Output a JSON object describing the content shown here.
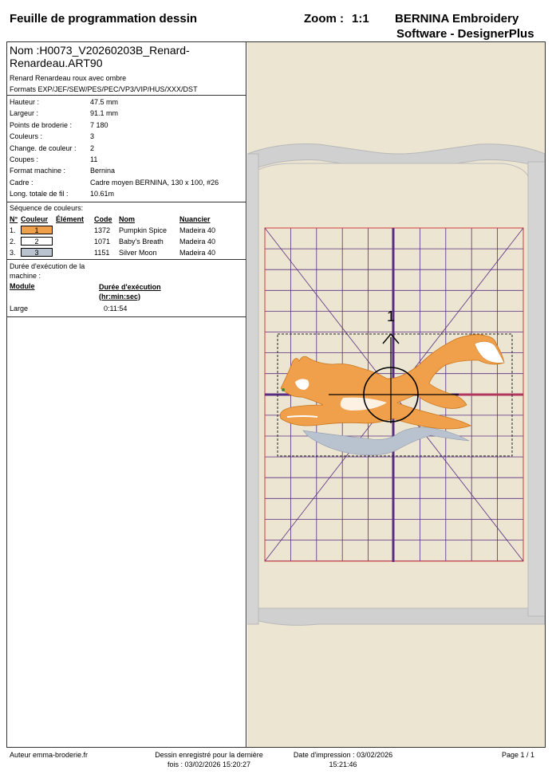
{
  "header": {
    "title": "Feuille de programmation dessin",
    "zoom_label": "Zoom :",
    "zoom_value": "1:1",
    "brand_line1": "BERNINA Embroidery",
    "brand_line2": "Software - DesignerPlus"
  },
  "design": {
    "name_line1": "Nom :H0073_V20260203B_Renard-",
    "name_line2": "Renardeau.ART90",
    "description": "Renard Renardeau roux avec ombre",
    "formats": "Formats EXP/JEF/SEW/PES/PEC/VP3/VIP/HUS/XXX/DST"
  },
  "properties": [
    {
      "label": "Hauteur :",
      "value": "47.5 mm"
    },
    {
      "label": "Largeur :",
      "value": "91.1 mm"
    },
    {
      "label": "Points de broderie :",
      "value": "7 180"
    },
    {
      "label": "Couleurs :",
      "value": "3"
    },
    {
      "label": "Change. de couleur :",
      "value": "2"
    },
    {
      "label": "Coupes :",
      "value": "11"
    },
    {
      "label": "Format machine :",
      "value": "Bernina"
    },
    {
      "label": "Cadre :",
      "value": "Cadre moyen BERNINA, 130 x 100, #26"
    },
    {
      "label": "Long. totale de fil :",
      "value": "10.61m"
    }
  ],
  "sequence": {
    "title": "Séquence de couleurs:",
    "headers": {
      "no": "N°",
      "color": "Couleur",
      "element": "Élément",
      "code": "Code",
      "name": "Nom",
      "nuancier": "Nuancier"
    },
    "rows": [
      {
        "no": "1.",
        "swatch_label": "1",
        "swatch_color": "#f0a04a",
        "code": "1372",
        "name": "Pumpkin Spice",
        "nuancier": "Madeira 40"
      },
      {
        "no": "2.",
        "swatch_label": "2",
        "swatch_color": "#ffffff",
        "code": "1071",
        "name": "Baby's Breath",
        "nuancier": "Madeira 40"
      },
      {
        "no": "3.",
        "swatch_label": "3",
        "swatch_color": "#b9c2cf",
        "code": "1151",
        "name": "Silver Moon",
        "nuancier": "Madeira 40"
      }
    ]
  },
  "duration": {
    "title_line1": "Durée d'exécution de la",
    "title_line2": "machine :",
    "module_header": "Module",
    "duration_header_line1": "Durée d'exécution",
    "duration_header_line2": "(hr:min:sec)",
    "module": "Large",
    "value": "0:11:54"
  },
  "preview": {
    "hoop_label": "1",
    "grid_color": "#5a2d82",
    "frame_color": "#d23c3c",
    "fox_color": "#f0a04a",
    "shadow_color": "#b9c2cf"
  },
  "footer": {
    "author": "Auteur emma-broderie.fr",
    "saved_line1": "Dessin enregistré pour la dernière",
    "saved_line2": "fois : 03/02/2026 15:20:27",
    "print_line1": "Date d'impression : 03/02/2026",
    "print_line2": "15:21:46",
    "page": "Page 1 / 1"
  }
}
